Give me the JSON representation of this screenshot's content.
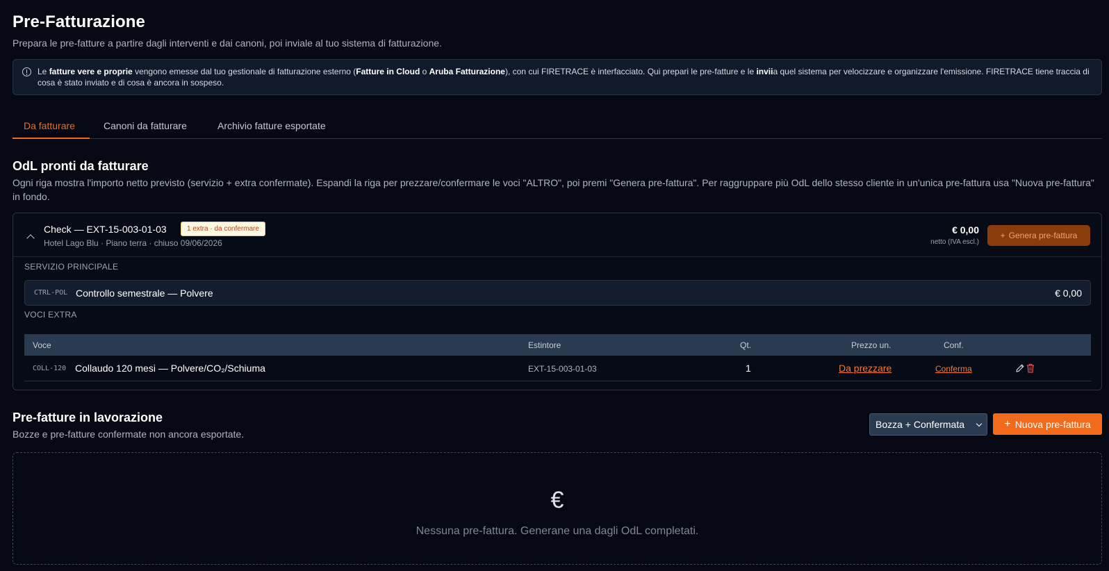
{
  "header": {
    "title": "Pre-Fatturazione",
    "subtitle": "Prepara le pre-fatture a partire dagli interventi e dai canoni, poi inviale al tuo sistema di fatturazione."
  },
  "info": {
    "t1": "Le ",
    "b1": "fatture vere e proprie",
    "t2": " vengono emesse dal tuo gestionale di fatturazione esterno (",
    "b2": "Fatture in Cloud",
    "t3": " o ",
    "b3": "Aruba Fatturazione",
    "t4": "), con cui FIRETRACE è interfacciato. Qui prepari le pre-fatture e le ",
    "b4": "invii",
    "t5": "a quel sistema per velocizzare e organizzare l'emissione. FIRETRACE tiene traccia di cosa è stato inviato e di cosa è ancora in sospeso."
  },
  "tabs": [
    {
      "label": "Da fatturare",
      "active": true
    },
    {
      "label": "Canoni da fatturare",
      "active": false
    },
    {
      "label": "Archivio fatture esportate",
      "active": false
    }
  ],
  "odl_section": {
    "title": "OdL pronti da fatturare",
    "description": "Ogni riga mostra l'importo netto previsto (servizio + extra confermate). Espandi la riga per prezzare/confermare le voci \"ALTRO\", poi premi \"Genera pre-fattura\". Per raggruppare più OdL dello stesso cliente in un'unica pre-fattura usa \"Nuova pre-fattura\" in fondo."
  },
  "odl": {
    "title": "Check — EXT-15-003-01-03",
    "badge": "1 extra · da confermare",
    "meta": "Hotel Lago Blu · Piano terra · chiuso 09/06/2026",
    "amount": "€ 0,00",
    "amount_note": "netto (IVA escl.)",
    "generate_label": "Genera pre-fattura",
    "service_label": "SERVIZIO PRINCIPALE",
    "service": {
      "code": "CTRL-POL",
      "name": "Controllo semestrale — Polvere",
      "price": "€ 0,00"
    },
    "extras_label": "VOCI EXTRA",
    "extras_headers": {
      "voce": "Voce",
      "estintore": "Estintore",
      "qty": "Qt.",
      "price": "Prezzo un.",
      "conf": "Conf."
    },
    "extras": [
      {
        "code": "COLL-120",
        "name": "Collaudo 120 mesi — Polvere/CO₂/Schiuma",
        "estintore": "EXT-15-003-01-03",
        "qty": "1",
        "price": "Da prezzare",
        "conf": "Conferma"
      }
    ]
  },
  "prefatture": {
    "title": "Pre-fatture in lavorazione",
    "description": "Bozze e pre-fatture confermate non ancora esportate.",
    "filter_value": "Bozza + Confermata",
    "new_label": "Nuova pre-fattura",
    "empty_text": "Nessuna pre-fattura. Generane una dagli OdL completati."
  },
  "colors": {
    "accent": "#f26b1d",
    "background": "#060913",
    "danger": "#e5484d"
  },
  "icons": [
    "info-icon",
    "chevron-up-icon",
    "plus-icon",
    "pencil-icon",
    "trash-icon",
    "chevron-down-icon",
    "euro-icon"
  ]
}
